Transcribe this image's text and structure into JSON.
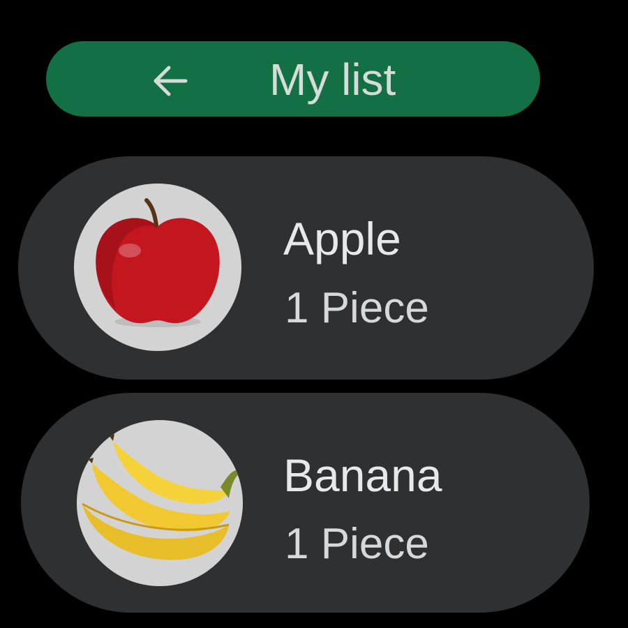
{
  "header": {
    "back_icon": "arrow-left-icon",
    "title": "My list",
    "background_color": "#137044"
  },
  "items": [
    {
      "name": "Apple",
      "quantity": "1 Piece",
      "image": "apple-image"
    },
    {
      "name": "Banana",
      "quantity": "1 Piece",
      "image": "banana-image"
    }
  ]
}
